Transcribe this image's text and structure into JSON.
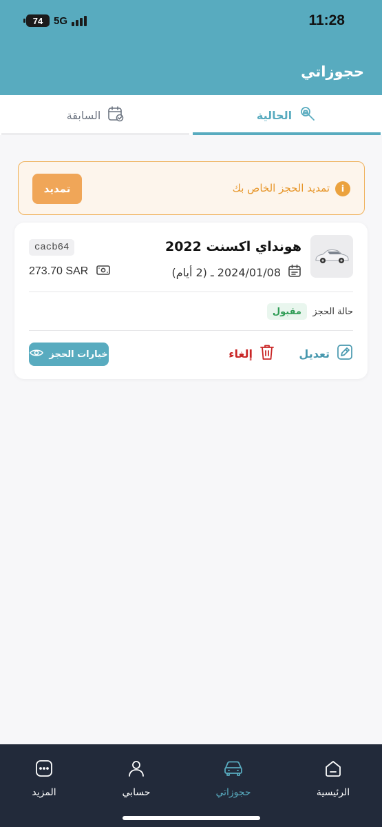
{
  "status_bar": {
    "time": "11:28",
    "battery": "74",
    "network": "5G"
  },
  "header": {
    "title": "حجوزاتي"
  },
  "tabs": [
    {
      "label": "الحالية",
      "icon": "car-search-icon",
      "active": true
    },
    {
      "label": "السابقة",
      "icon": "calendar-check-icon",
      "active": false
    }
  ],
  "alert": {
    "icon": "info-icon",
    "text": "تمديد الحجز الخاص بك",
    "button_label": "تمديد"
  },
  "booking": {
    "car_name": "هونداي اكسنت 2022",
    "dates": "2024/01/08 ـ (2 أيام)",
    "plate": "cacb64",
    "price": "273.70 SAR",
    "status_label": "حالة الحجز",
    "status_value": "مقبول",
    "edit_label": "تعديل",
    "cancel_label": "إلغاء",
    "options_label": "خيارات الحجز"
  },
  "bottom_nav": [
    {
      "label": "الرئيسية",
      "icon": "home-icon",
      "active": false
    },
    {
      "label": "حجوزاتي",
      "icon": "car-icon",
      "active": true
    },
    {
      "label": "حسابي",
      "icon": "user-icon",
      "active": false
    },
    {
      "label": "المزيد",
      "icon": "more-icon",
      "active": false
    }
  ],
  "colors": {
    "primary": "#58abbf",
    "warning": "#f0a658",
    "success": "#2e9c55",
    "danger": "#c92626",
    "nav_bg": "#222a3a"
  }
}
